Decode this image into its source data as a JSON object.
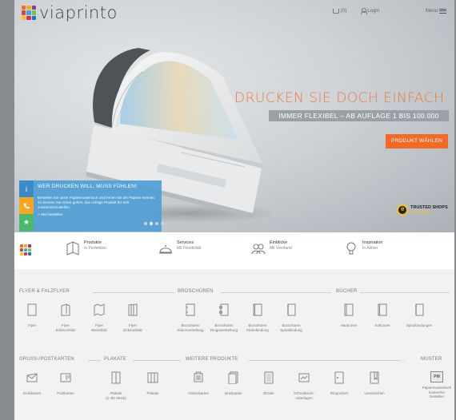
{
  "brand": {
    "name": "viaprinto",
    "colors": [
      "#f26a25",
      "#f7a81b",
      "#8e3c8f",
      "#e8412b",
      "#3fa7dc",
      "#7dbf44",
      "#f5c228",
      "#d8315a",
      "#1e73b8"
    ]
  },
  "topnav": {
    "cart": "(0)",
    "login": "Login",
    "menu": "Menu"
  },
  "hero": {
    "headline": "DRUCKEN SIE DOCH EINFACH.",
    "subline": "IMMER FLEXIBEL – AB AUFLAGE 1 BIS 100.000",
    "cta": "PRODUKT WÄHLEN",
    "accent": "#f26a25"
  },
  "info_panel": {
    "title": "WER DRUCKEN WILL, MUSS FÜHLEN!",
    "body": "Bestellen Sie unser Papiermustertuch und lernen Sie die Papiere kennen. So können Sie sicher gehen, das richtige Produkt für sich zusammenzustellen.",
    "link": "> Hier bestellen",
    "icons": [
      "info-icon",
      "phone-icon",
      "star-icon"
    ],
    "color": "#4f9ed6"
  },
  "carousel": {
    "slides": 4,
    "active": 2
  },
  "trusted": {
    "label": "TRUSTED SHOPS",
    "stars": "★★★★★"
  },
  "features": [
    {
      "title": "Produkte",
      "subtitle": "In Perfektion"
    },
    {
      "title": "Services",
      "subtitle": "Mit Flexibilität"
    },
    {
      "title": "Einblicke",
      "subtitle": "Mit Verstand"
    },
    {
      "title": "Inspiration",
      "subtitle": "In Aktion"
    }
  ],
  "categories": {
    "flyer": {
      "label": "FLYER & FALZFLYER",
      "items": [
        "Flyer",
        "Flyer\nEinbruchfalz",
        "Flyer\nWickelfalz",
        "Flyer\nZickzackfalz"
      ]
    },
    "broschueren": {
      "label": "BROSCHÜREN",
      "items": [
        "Broschüren\nKlammerheftung",
        "Broschüren\nRingösenheftung",
        "Broschüren\nKlebebindung",
        "Broschüren\nSpiralbindung"
      ]
    },
    "buecher": {
      "label": "BÜCHER",
      "items": [
        "Hardcover",
        "Softcover",
        "Spiralbindungen"
      ]
    },
    "gruss": {
      "label": "GRUSS-/POSTKARTEN",
      "items": [
        "Grußkarten",
        "Postkarten"
      ]
    },
    "plakate": {
      "label": "PLAKATE",
      "items": [
        "Plakate\n(1–50 Stück)",
        "Plakate"
      ]
    },
    "weitere": {
      "label": "WEITERE PRODUKTE",
      "items": [
        "Visitenkarten",
        "Briefpapier",
        "Blöcke",
        "Schreibtisch-\nunterlagen",
        "Ringordner",
        "Lesezeichen"
      ]
    },
    "muster": {
      "label": "MUSTER",
      "items": [
        "Papiermusterbuch\nkostenfrei\nbestellen"
      ],
      "badge": "PM"
    }
  }
}
